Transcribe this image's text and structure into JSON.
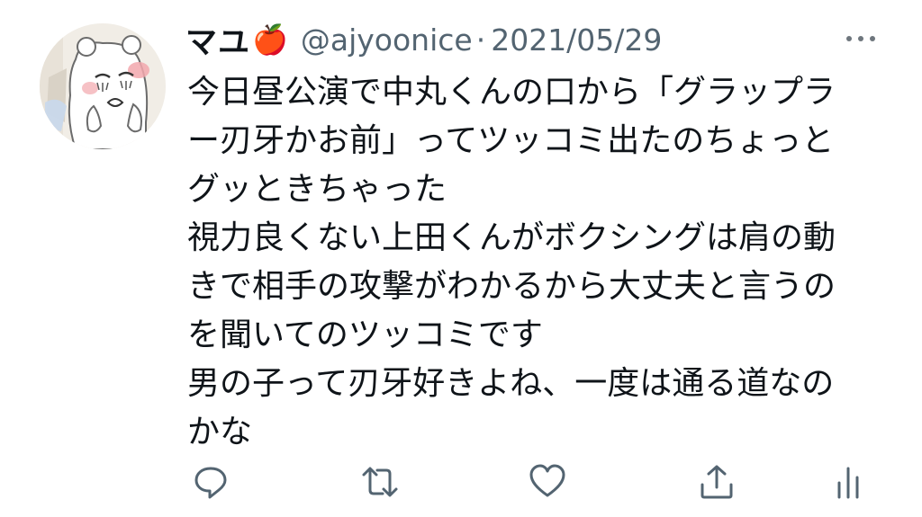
{
  "tweet": {
    "display_name": "マユ",
    "name_emoji": "🍎",
    "handle": "@ajyoonice",
    "separator": "·",
    "date": "2021/05/29",
    "more_icon": "more-horizontal-icon",
    "lines": [
      "今日昼公演で中丸くんの口から「グラップラ",
      "ー刃牙かお前」ってツッコミ出たのちょっと",
      "グッときちゃった",
      "視力良くない上田くんがボクシングは肩の動",
      "きで相手の攻撃がわかるから大丈夫と言うの",
      "を聞いてのツッコミです",
      "男の子って刃牙好きよね、一度は通る道なの",
      "かな"
    ]
  },
  "actions": {
    "reply_icon": "reply-icon",
    "retweet_icon": "retweet-icon",
    "like_icon": "heart-icon",
    "share_icon": "share-icon",
    "analytics_icon": "analytics-icon"
  },
  "colors": {
    "text": "#0f1419",
    "secondary": "#536471",
    "action_icon": "#536471"
  }
}
